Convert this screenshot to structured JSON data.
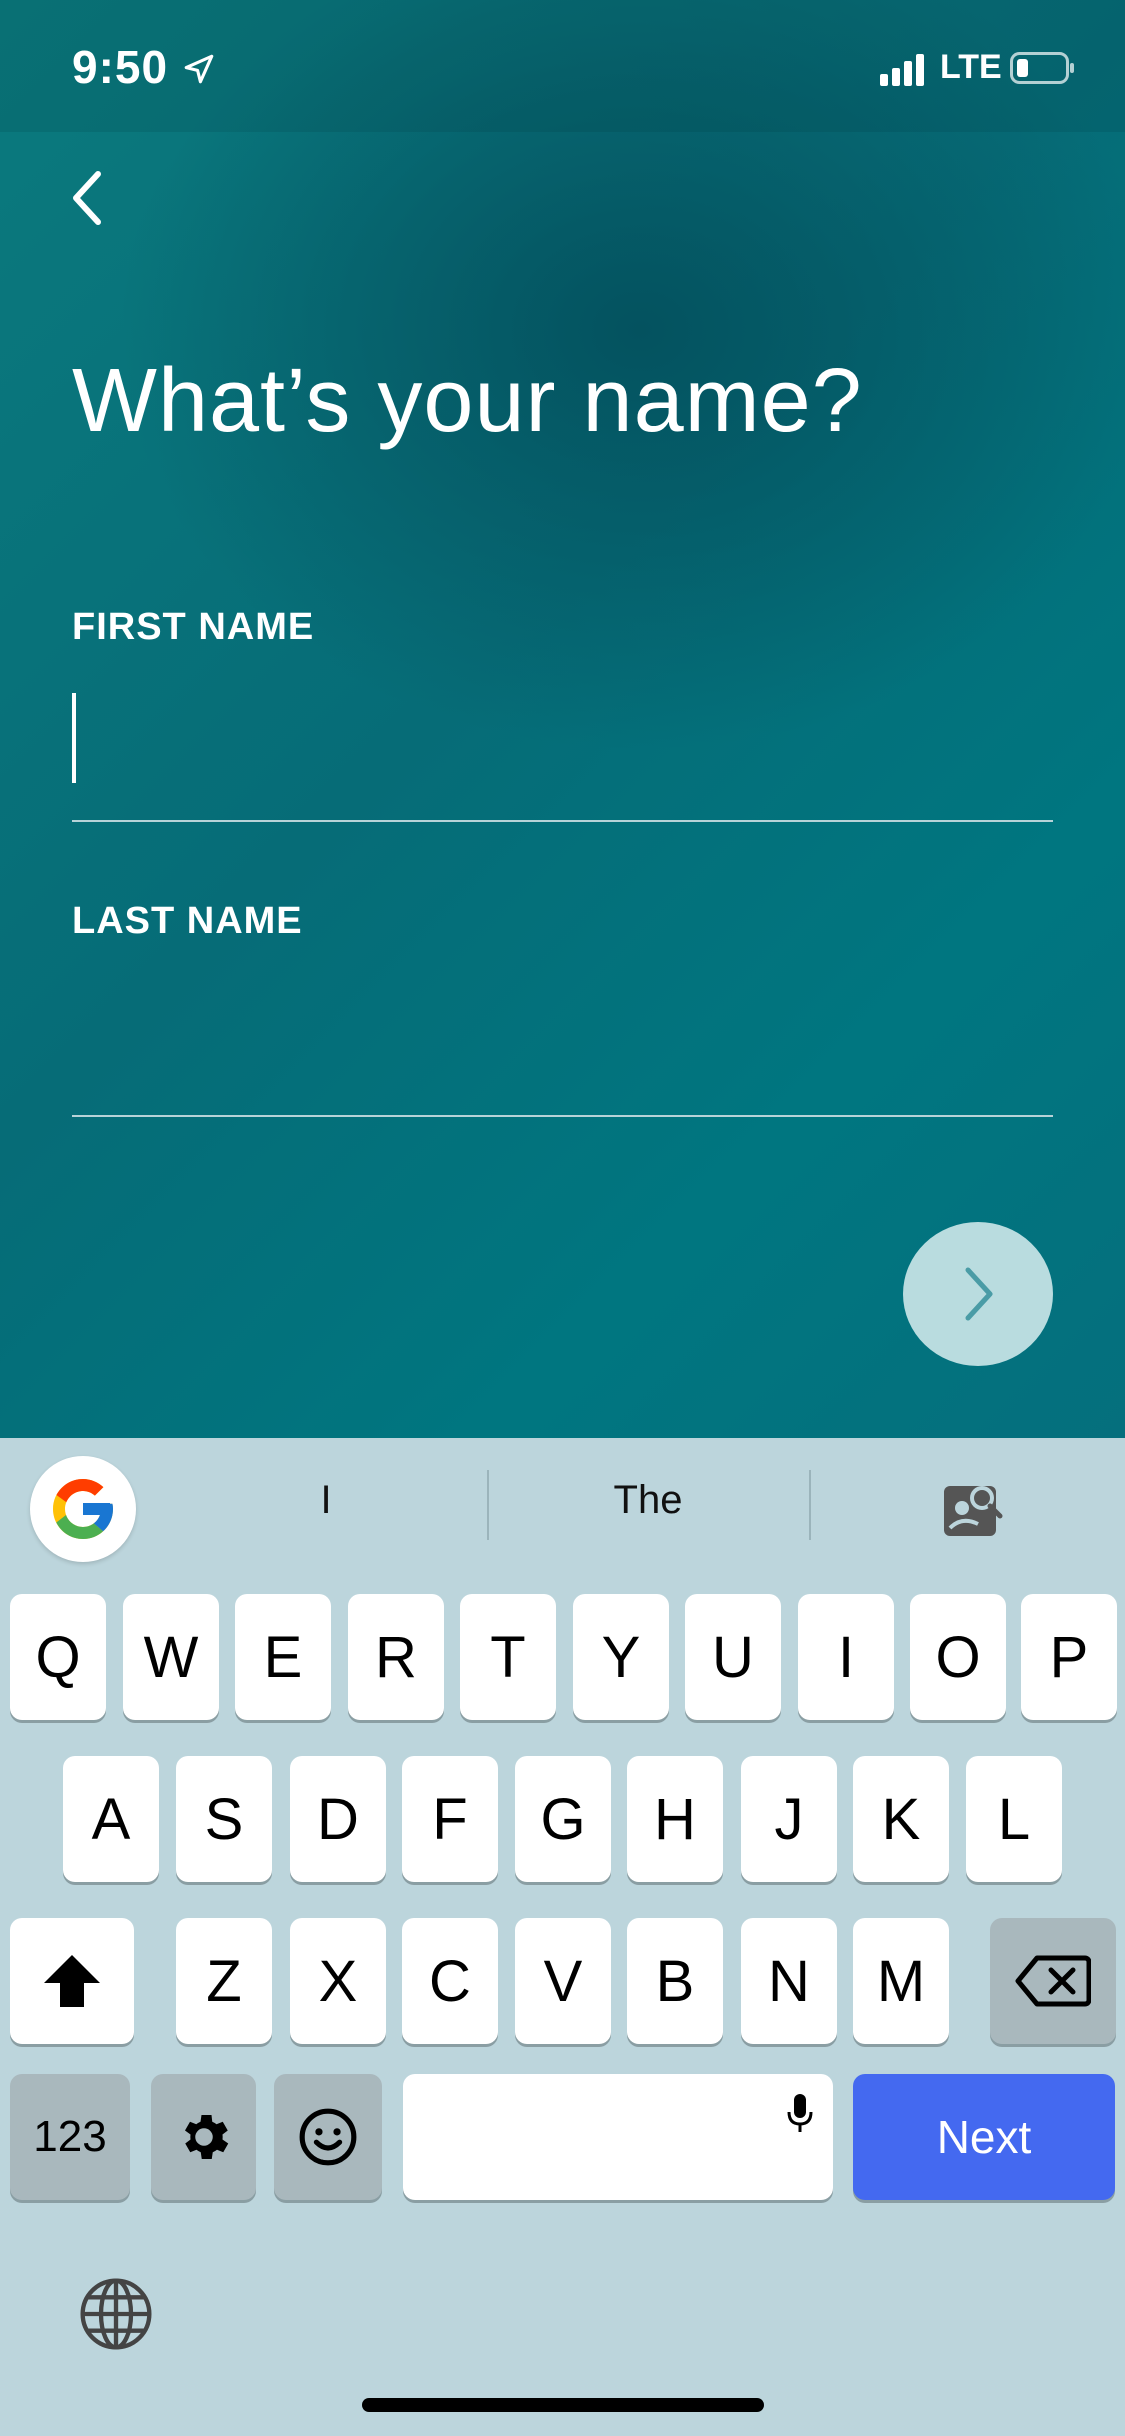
{
  "status_bar": {
    "time": "9:50",
    "network": "LTE"
  },
  "screen": {
    "title": "What’s your name?",
    "first_name": {
      "label": "FIRST NAME",
      "value": ""
    },
    "last_name": {
      "label": "LAST NAME",
      "value": ""
    }
  },
  "colors": {
    "accent": "#4469f0",
    "background": "#066c77",
    "next_circle": "#b9dcdf"
  },
  "keyboard": {
    "suggestions": [
      "I",
      "The"
    ],
    "row1": [
      "Q",
      "W",
      "E",
      "R",
      "T",
      "Y",
      "U",
      "I",
      "O",
      "P"
    ],
    "row2": [
      "A",
      "S",
      "D",
      "F",
      "G",
      "H",
      "J",
      "K",
      "L"
    ],
    "row3": [
      "Z",
      "X",
      "C",
      "V",
      "B",
      "N",
      "M"
    ],
    "numbers_label": "123",
    "next_label": "Next"
  }
}
